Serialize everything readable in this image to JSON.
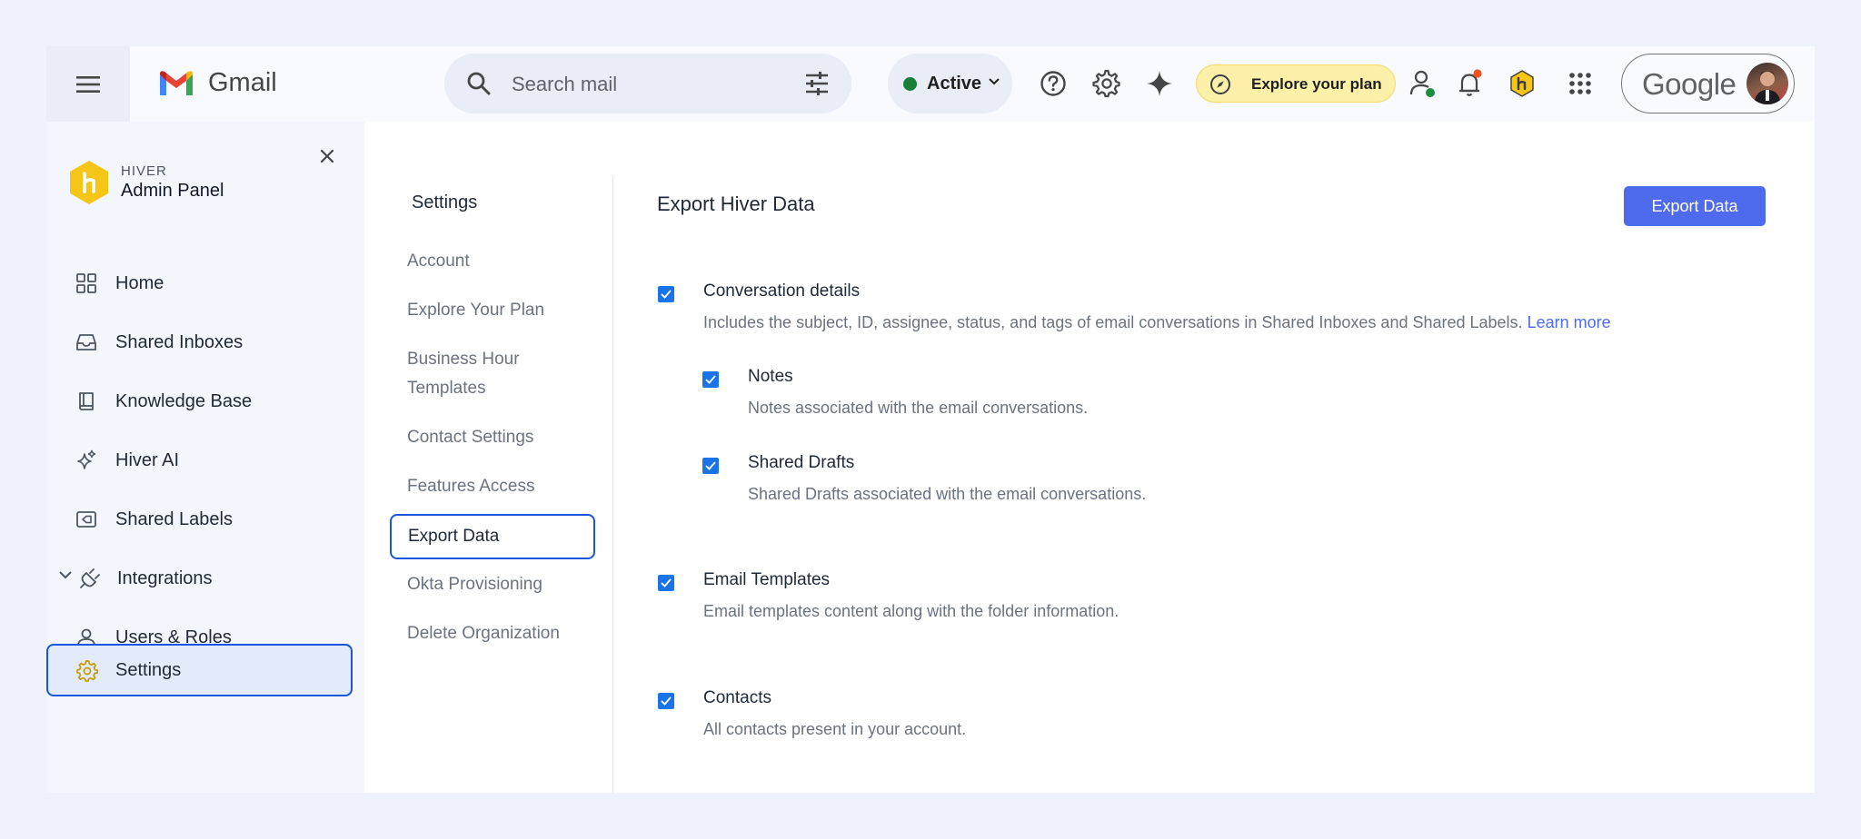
{
  "gmail": {
    "app_name": "Gmail",
    "search_placeholder": "Search mail",
    "status_label": "Active",
    "explore_label": "Explore your plan",
    "account_brand": "Google"
  },
  "admin": {
    "brand_top": "HIVER",
    "brand_title": "Admin Panel",
    "items": [
      {
        "label": "Home",
        "icon": "grid-icon"
      },
      {
        "label": "Shared Inboxes",
        "icon": "inbox-icon"
      },
      {
        "label": "Knowledge Base",
        "icon": "book-icon"
      },
      {
        "label": "Hiver AI",
        "icon": "sparkle-icon"
      },
      {
        "label": "Shared Labels",
        "icon": "label-icon"
      },
      {
        "label": "Integrations",
        "icon": "plug-icon"
      },
      {
        "label": "Users & Roles",
        "icon": "user-icon"
      },
      {
        "label": "Settings",
        "icon": "gear-icon",
        "active": true
      }
    ]
  },
  "settings": {
    "title": "Settings",
    "items": [
      {
        "label": "Account"
      },
      {
        "label": "Explore Your Plan"
      },
      {
        "label": "Business Hour Templates"
      },
      {
        "label": "Contact Settings"
      },
      {
        "label": "Features Access"
      },
      {
        "label": "Export Data",
        "active": true
      },
      {
        "label": "Okta Provisioning"
      },
      {
        "label": "Delete Organization"
      }
    ]
  },
  "export": {
    "title": "Export Hiver Data",
    "button_label": "Export Data",
    "options": [
      {
        "title": "Conversation details",
        "desc": "Includes the subject, ID, assignee, status, and tags of email conversations in Shared Inboxes and Shared Labels.",
        "link": "Learn more",
        "checked": true
      },
      {
        "title": "Notes",
        "desc": "Notes associated with the email conversations.",
        "checked": true
      },
      {
        "title": "Shared Drafts",
        "desc": "Shared Drafts associated with the email conversations.",
        "checked": true
      },
      {
        "title": "Email Templates",
        "desc": "Email templates content along with the folder information.",
        "checked": true
      },
      {
        "title": "Contacts",
        "desc": "All contacts present in your account.",
        "checked": true
      }
    ]
  },
  "colors": {
    "accent": "#1a56db",
    "button": "#4f6bed",
    "checkbox": "#1a73e8",
    "hiver_yellow": "#f5c518"
  }
}
